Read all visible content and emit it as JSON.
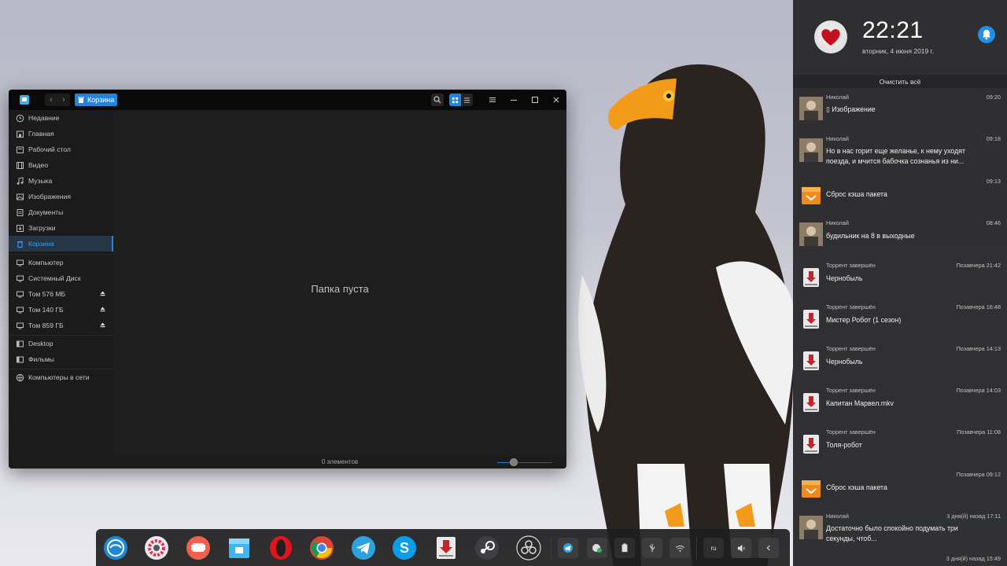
{
  "file_manager": {
    "breadcrumb": "Корзина",
    "sidebar": [
      {
        "label": "Недавние",
        "icon": "clock-icon"
      },
      {
        "label": "Главная",
        "icon": "home-icon"
      },
      {
        "label": "Рабочий стол",
        "icon": "desktop-icon"
      },
      {
        "label": "Видео",
        "icon": "video-icon"
      },
      {
        "label": "Музыка",
        "icon": "music-icon"
      },
      {
        "label": "Изображения",
        "icon": "image-icon"
      },
      {
        "label": "Документы",
        "icon": "document-icon"
      },
      {
        "label": "Загрузки",
        "icon": "download-icon"
      },
      {
        "label": "Корзина",
        "icon": "trash-icon",
        "active": true
      },
      {
        "label": "Компьютер",
        "icon": "computer-icon"
      },
      {
        "label": "Системный Диск",
        "icon": "disk-icon"
      },
      {
        "label": "Том 576 МБ",
        "icon": "disk-icon",
        "ejectable": true
      },
      {
        "label": "Том 140 ГБ",
        "icon": "disk-icon",
        "ejectable": true
      },
      {
        "label": "Том 859 ГБ",
        "icon": "disk-icon",
        "ejectable": true
      },
      {
        "label": "Desktop",
        "icon": "bookmark-icon"
      },
      {
        "label": "Фильмы",
        "icon": "bookmark-icon"
      },
      {
        "label": "Компьютеры в сети",
        "icon": "network-icon"
      }
    ],
    "empty_message": "Папка пуста",
    "status": "0 элементов",
    "zoom_level": 0.3,
    "accent": "#2684d8"
  },
  "notification_center": {
    "time": "22:21",
    "date": "вторник, 4 июня 2019 г.",
    "clear_all": "Очистить всё",
    "notifications": [
      {
        "app": "Николай",
        "time": "09:20",
        "body": "▯ Изображение",
        "icon": "user-photo-icon"
      },
      {
        "app": "Николай",
        "time": "09:18",
        "body": "Но в нас горит еще желанье, к нему уходят поезда, и мчится бабочка сознанья из ни...",
        "icon": "user-photo-icon"
      },
      {
        "app": "",
        "time": "09:13",
        "body": "Сброс кэша пакета",
        "icon": "package-icon"
      },
      {
        "app": "Николай",
        "time": "08:46",
        "body": "будильник на 8 в выходные",
        "icon": "user-photo-icon"
      },
      {
        "app": "Торрент завершён",
        "time": "Позавчера 21:42",
        "body": "Чернобыль",
        "icon": "torrent-icon"
      },
      {
        "app": "Торрент завершён",
        "time": "Позавчера 16:48",
        "body": "Мистер Робот (1 сезон)",
        "icon": "torrent-icon"
      },
      {
        "app": "Торрент завершён",
        "time": "Позавчера 14:13",
        "body": "Чернобыль",
        "icon": "torrent-icon"
      },
      {
        "app": "Торрент завершён",
        "time": "Позавчера 14:03",
        "body": "Капитан Марвел.mkv",
        "icon": "torrent-icon"
      },
      {
        "app": "Торрент завершён",
        "time": "Позавчера 11:08",
        "body": "Толя-робот",
        "icon": "torrent-icon"
      },
      {
        "app": "",
        "time": "Позавчера 09:12",
        "body": "Сброс кэша пакета",
        "icon": "package-icon"
      },
      {
        "app": "Николай",
        "time": "3 дня(й) назад 17:11",
        "body": "Достаточно было спокойно подумать три секунды, чтоб...",
        "icon": "user-photo-icon"
      },
      {
        "app": "",
        "time": "3 дня(й) назад 15:49",
        "body": "",
        "icon": ""
      }
    ]
  },
  "dock": {
    "apps": [
      "launcher-icon",
      "settings-icon",
      "presentation-icon",
      "file-manager-icon",
      "opera-icon",
      "chrome-icon",
      "telegram-icon",
      "skype-icon",
      "torrent-icon",
      "steam-icon",
      "obs-icon"
    ],
    "tray": [
      "telegram-tray-icon",
      "network-manager-icon",
      "battery-icon",
      "usb-icon",
      "wifi-icon",
      "ru",
      "volume-icon",
      "chevron-left-icon"
    ],
    "language": "ru"
  }
}
